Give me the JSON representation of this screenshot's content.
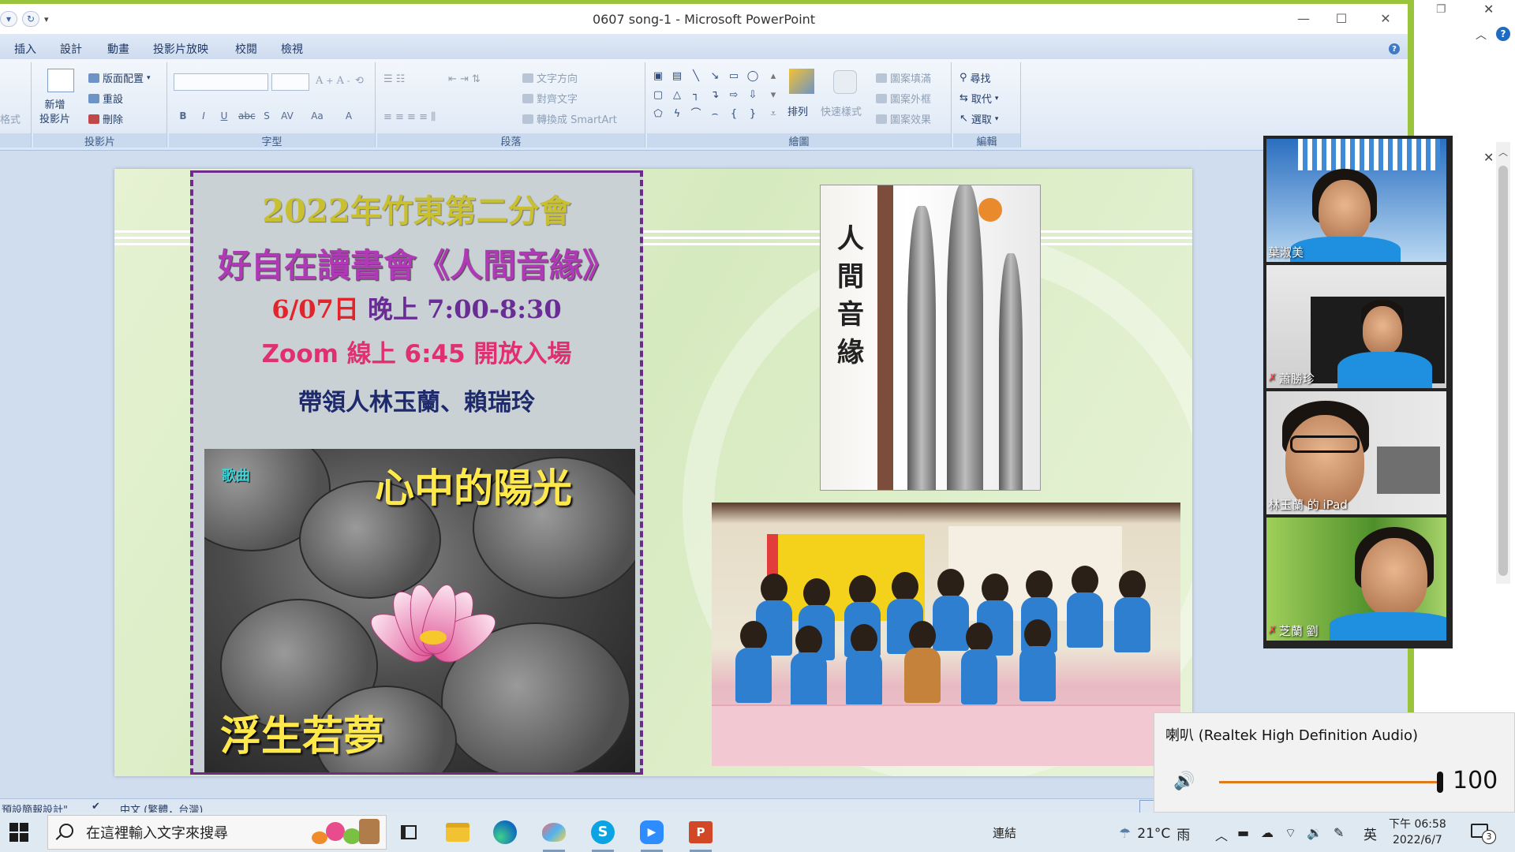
{
  "window": {
    "title": "0607 song-1 - Microsoft PowerPoint"
  },
  "ribbon_tabs": [
    "插入",
    "設計",
    "動畫",
    "投影片放映",
    "校閱",
    "檢視"
  ],
  "ribbon": {
    "slides_group": {
      "label": "投影片",
      "new_slide": "新增\n投影片",
      "layout": "版面配置",
      "reset": "重設",
      "delete": "刪除",
      "partial_left": "格式"
    },
    "font_group": {
      "label": "字型"
    },
    "paragraph_group": {
      "label": "段落",
      "text_direction": "文字方向",
      "align_text": "對齊文字",
      "convert_smartart": "轉換成 SmartArt"
    },
    "drawing_group": {
      "label": "繪圖",
      "arrange": "排列",
      "quick_styles": "快速樣式",
      "shape_fill": "圖案填滿",
      "shape_outline": "圖案外框",
      "shape_effects": "圖案效果"
    },
    "editing_group": {
      "label": "編輯",
      "find": "尋找",
      "replace": "取代",
      "select": "選取"
    }
  },
  "slide": {
    "line1": "2022年竹東第二分會",
    "line2": "好自在讀書會《人間音緣》",
    "line3_date": "6/07日",
    "line3_time": " 晚上 7:00-8:30",
    "line4": "Zoom 線上 6:45 開放入場",
    "line5": "帶領人林玉蘭、賴瑞玲",
    "song_tag": "歌曲",
    "song_title": "心中的陽光",
    "song_subtitle": "浮生若夢",
    "book_title": "人間音緣"
  },
  "statusbar": {
    "theme": "預設簡報設計\"",
    "language": "中文 (繁體，台灣)"
  },
  "zoom_participants": [
    {
      "name": "葉淑美",
      "muted": false
    },
    {
      "name": "蕭勝珍",
      "muted": true
    },
    {
      "name": "林玉蘭 的 iPad",
      "muted": false
    },
    {
      "name": "芝蘭 劉",
      "muted": true
    }
  ],
  "volume": {
    "device": "喇叭 (Realtek High Definition Audio)",
    "level": 100
  },
  "taskbar": {
    "search_placeholder": "在這裡輸入文字來搜尋",
    "tray_link": "連結",
    "weather_temp": "21°C",
    "weather_cond": "雨",
    "ime": "英",
    "time": "下午 06:58",
    "date": "2022/6/7",
    "notifications": "3"
  },
  "colors": {
    "accent_green": "#9ac43c",
    "panel_border": "#6d2b8c",
    "title_green": "#c8c030",
    "date_red": "#e3242b",
    "time_purple": "#6a2c95",
    "zoom_pink": "#e0306f",
    "leader_navy": "#1f2a6b",
    "song_yellow": "#ffe94a"
  }
}
